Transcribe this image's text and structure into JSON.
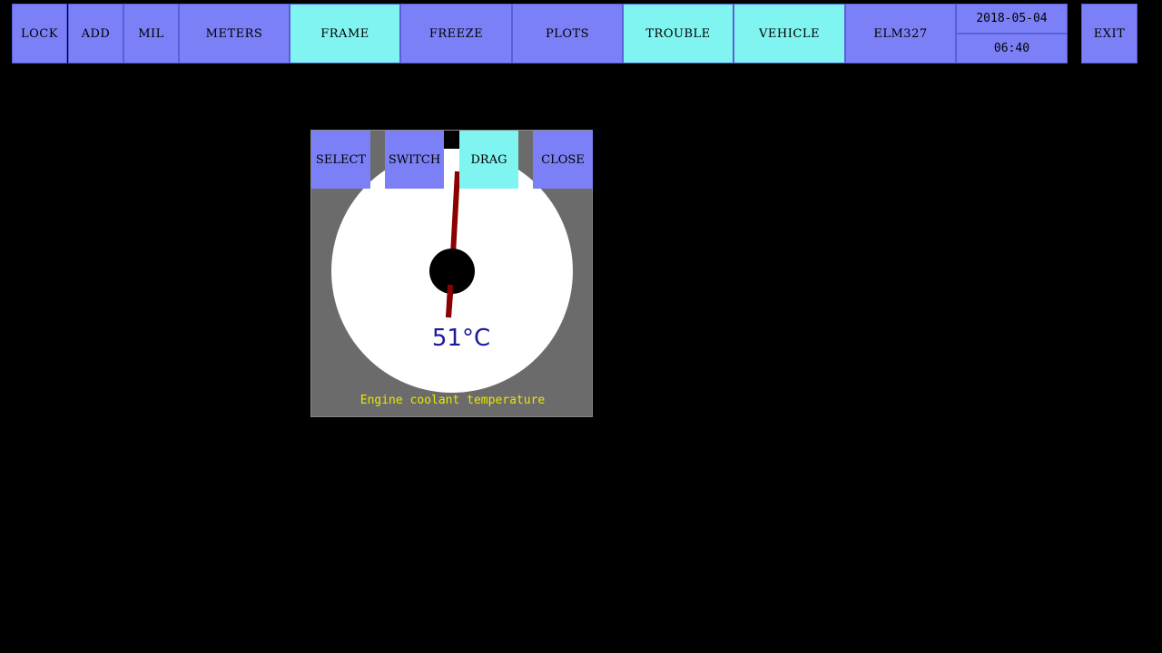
{
  "toolbar": {
    "buttons": [
      {
        "label": "LOCK",
        "style": "blue"
      },
      {
        "label": "ADD",
        "style": "blue"
      },
      {
        "label": "MIL",
        "style": "blue"
      },
      {
        "label": "METERS",
        "style": "blue"
      },
      {
        "label": "FRAME",
        "style": "cyan"
      },
      {
        "label": "FREEZE",
        "style": "blue"
      },
      {
        "label": "PLOTS",
        "style": "blue"
      },
      {
        "label": "TROUBLE",
        "style": "cyan"
      },
      {
        "label": "VEHICLE",
        "style": "cyan"
      },
      {
        "label": "ELM327",
        "style": "blue"
      }
    ],
    "date": "2018-05-04",
    "time": "06:40",
    "exit_label": "EXIT"
  },
  "gauge": {
    "buttons": {
      "select": "SELECT",
      "switch": "SWITCH",
      "drag": "DRAG",
      "close": "CLOSE"
    },
    "value": 51,
    "unit": "°C",
    "readout": "51°C",
    "caption": "Engine coolant temperature"
  },
  "colors": {
    "button_blue": "#7b80f6",
    "button_cyan": "#7ff4f0",
    "background": "#000000",
    "window_gray": "#6b6b6b",
    "needle": "#8b0000",
    "readout_text": "#1a1a9a",
    "caption_text": "#e8e800"
  }
}
